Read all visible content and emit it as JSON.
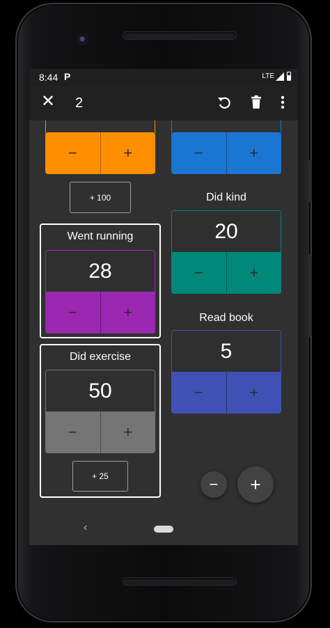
{
  "status": {
    "time": "8:44",
    "app_letter": "P",
    "network": "LTE"
  },
  "toolbar": {
    "selected_count": "2"
  },
  "icons": {
    "close": "close-icon",
    "reset": "reset-icon",
    "delete": "trash-icon",
    "more": "more-vert-icon",
    "back": "back-icon",
    "home": "home-pill-icon"
  },
  "colors": {
    "orange": "#ff8f00",
    "blue": "#1976d2",
    "teal": "#00897b",
    "purple": "#9c27b0",
    "gray": "#757575",
    "indigo": "#3f51b5"
  },
  "counters": {
    "top_left": {
      "minus": "−",
      "plus": "+"
    },
    "top_right": {
      "minus": "−",
      "plus": "+"
    },
    "went_running": {
      "name": "Went running",
      "value": "28",
      "minus": "−",
      "plus": "+"
    },
    "did_exercise": {
      "name": "Did exercise",
      "value": "50",
      "minus": "−",
      "plus": "+"
    },
    "did_kind": {
      "name": "Did kind",
      "value": "20",
      "minus": "−",
      "plus": "+"
    },
    "read_book": {
      "name": "Read book",
      "value": "5",
      "minus": "−",
      "plus": "+"
    }
  },
  "increments": {
    "plus_100": "+ 100",
    "plus_25": "+ 25"
  },
  "fabs": {
    "minus": "−",
    "plus": "+"
  },
  "nav": {
    "back": "‹"
  }
}
